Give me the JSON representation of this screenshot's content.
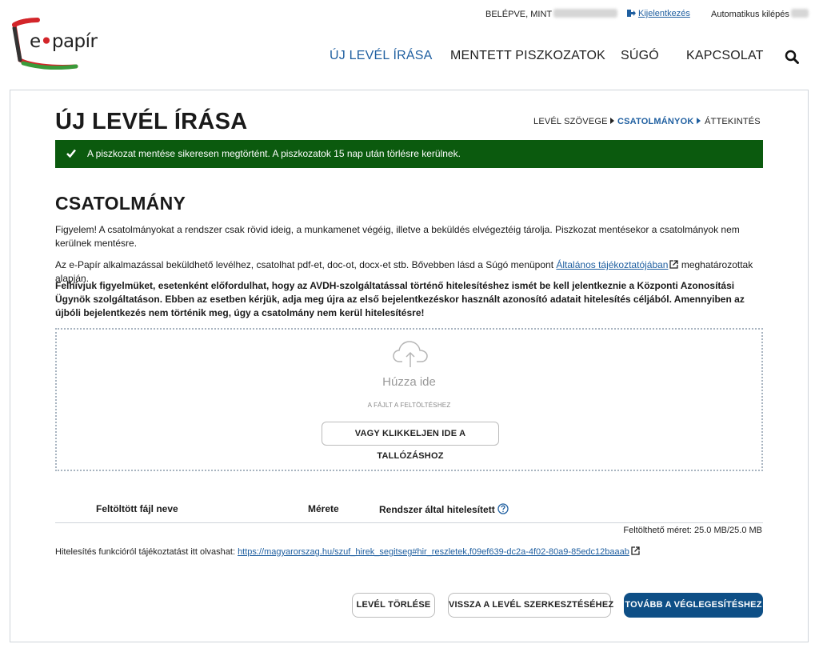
{
  "header": {
    "logged_in_label": "BELÉPVE, MINT",
    "logout_label": "Kijelentkezés",
    "auto_logout_label": "Automatikus kilépés",
    "logo_text_e": "e",
    "logo_text_rest": "papír"
  },
  "nav": {
    "items": [
      {
        "label": "ÚJ LEVÉL ÍRÁSA",
        "active": true
      },
      {
        "label": "MENTETT PISZKOZATOK",
        "active": false
      },
      {
        "label": "SÚGÓ",
        "active": false
      },
      {
        "label": "KAPCSOLAT",
        "active": false
      }
    ],
    "search_icon": "search-icon"
  },
  "page": {
    "title": "ÚJ LEVÉL ÍRÁSA",
    "steps": [
      {
        "label": "LEVÉL SZÖVEGE",
        "active": false
      },
      {
        "label": "CSATOLMÁNYOK",
        "active": true
      },
      {
        "label": "ÁTTEKINTÉS",
        "active": false
      }
    ],
    "alert": "A piszkozat mentése sikeresen megtörtént. A piszkozatok 15 nap után törlésre kerülnek."
  },
  "attachment": {
    "title": "CSATOLMÁNY",
    "para1": "Figyelem! A csatolmányokat a rendszer csak rövid ideig, a munkamenet végéig, illetve a beküldés elvégeztéig tárolja. Piszkozat mentésekor a csatolmányok nem kerülnek mentésre.",
    "para2_before": "Az e-Papír alkalmazással beküldhető levélhez, csatolhat pdf-et, doc-ot, docx-et stb. Bővebben lásd a Súgó menüpont ",
    "para2_link": "Általános tájékoztatójában",
    "para2_after": " meghatározottak alapján.",
    "para3": "Felhívjuk figyelmüket, esetenként előfordulhat, hogy az AVDH-szolgáltatással történő hitelesítéshez ismét be kell jelentkeznie a Központi Azonosítási Ügynök szolgáltatáson. Ebben az esetben kérjük, adja meg újra az első bejelentkezéskor használt azonosító adatait hitelesítés céljából. Amennyiben az újbóli bejelentkezés nem történik meg, úgy a csatolmány nem kerül hitelesítésre!",
    "dropzone": {
      "title": "Húzza ide",
      "subtitle": "A FÁJLT A FELTÖLTÉSHEZ",
      "browse_label": "VAGY KLIKKELJEN IDE A TALLÓZÁSHOZ"
    },
    "table": {
      "col_name": "Feltöltött fájl neve",
      "col_size": "Mérete",
      "col_auth": "Rendszer által hitelesített"
    },
    "size_info": "Feltölthető méret: 25.0 MB/25.0 MB",
    "auth_info_before": "Hitelesítés funkcióról tájékoztatást itt olvashat: ",
    "auth_info_link": "https://magyarorszag.hu/szuf_hirek_segitseg#hir_reszletek,f09ef639-dc2a-4f02-80a9-85edc12baaab"
  },
  "actions": {
    "delete_label": "LEVÉL TÖRLÉSE",
    "back_label": "VISSZA A LEVÉL SZERKESZTÉSÉHEZ",
    "next_label": "TOVÁBB A VÉGLEGESÍTÉSHEZ"
  },
  "colors": {
    "accent": "#1f5fa0",
    "success": "#0b5a0e",
    "primary_button": "#0e4f86",
    "logo_red": "#d3252a",
    "logo_green": "#3a9a3a"
  }
}
